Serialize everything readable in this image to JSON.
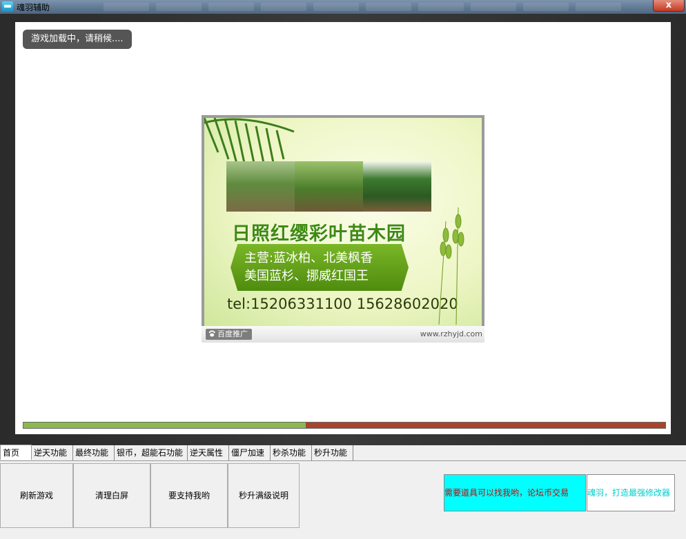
{
  "window": {
    "title": "魂羽辅助",
    "close_glyph": "x"
  },
  "game": {
    "loading_text": "游戏加载中，请稍候....",
    "progress": 0.44,
    "ad": {
      "company": "日照红缨彩叶苗木园",
      "line1": "主营:蓝冰柏、北美枫香",
      "line2": "美国蓝杉、挪威红国王",
      "tel": "tel:15206331100   15628602020",
      "footer_tag": "百度推广",
      "footer_url": "www.rzhyjd.com"
    }
  },
  "tabs": [
    {
      "label": "首页",
      "active": true
    },
    {
      "label": "逆天功能"
    },
    {
      "label": "最终功能"
    },
    {
      "label": "银币，超能石功能"
    },
    {
      "label": "逆天属性"
    },
    {
      "label": "僵尸加速"
    },
    {
      "label": "秒杀功能"
    },
    {
      "label": "秒升功能"
    }
  ],
  "buttons": {
    "refresh": "刷新游戏",
    "clear": "清理白屏",
    "support": "要支持我哟",
    "help": "秒升满级说明"
  },
  "info": {
    "trade_notice": "需要道具可以找我哟，论坛币交易",
    "slogan": "魂羽，打造最强修改器"
  },
  "colors": {
    "progress_done": "#8cb84f",
    "progress_remaining": "#a7442b",
    "cyan_panel": "#00ffff"
  }
}
